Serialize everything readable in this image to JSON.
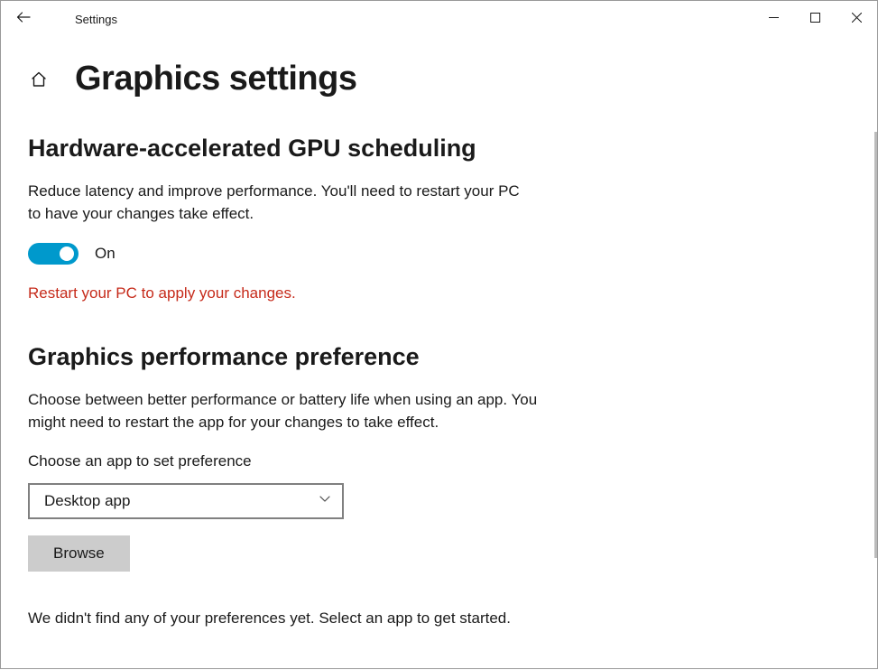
{
  "window": {
    "title": "Settings"
  },
  "page": {
    "title": "Graphics settings"
  },
  "gpu_sched": {
    "heading": "Hardware-accelerated GPU scheduling",
    "description": "Reduce latency and improve performance. You'll need to restart your PC to have your changes take effect.",
    "toggle_state": "On",
    "warning": "Restart your PC to apply your changes."
  },
  "perf_pref": {
    "heading": "Graphics performance preference",
    "description": "Choose between better performance or battery life when using an app. You might need to restart the app for your changes to take effect.",
    "choose_label": "Choose an app to set preference",
    "dropdown_value": "Desktop app",
    "browse_label": "Browse",
    "empty_msg": "We didn't find any of your preferences yet. Select an app to get started."
  }
}
